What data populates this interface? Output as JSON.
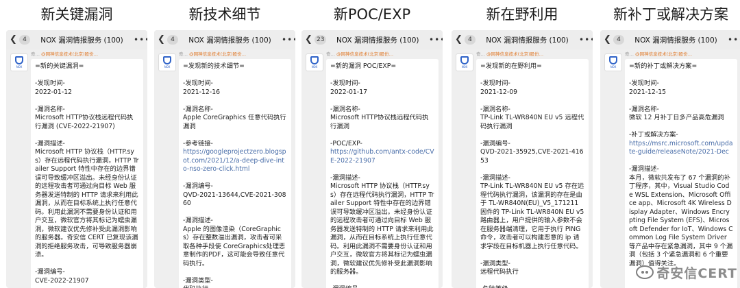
{
  "columns": [
    {
      "heading": "新关键漏洞",
      "badge": "4",
      "title": "NOX 漏洞情报服务 (100)",
      "sender_prefix": "奇…",
      "sender_org": "@网神信息技术(北京)股份…",
      "lines": [
        "=新的关键漏洞=",
        "",
        "-发现时间-",
        "2022-01-12",
        "",
        "-漏洞名称-",
        "Microsoft HTTP协议栈远程代码执行漏洞 (CVE-2022-21907)",
        "",
        "-漏洞描述-",
        "Microsoft HTTP 协议栈（HTTP.sys）存在远程代码执行漏洞，HTTP Trailer Support 特性中存在的边界错误可导致缓冲区溢出。未经身份认证的远程攻击者可通过向目标 Web 服务器发送特制的 HTTP 请求来利用此漏洞，从而在目标系统上执行任意代码。利用此漏洞不需要身份认证和用户交互，微软官方将其标记为蠕虫漏洞，微软建议优先修补受此漏洞影响的服务器。奇安信 CERT 已复现该漏洞的拒绝服务攻击，可导致服务器崩溃。",
        "",
        "-漏洞编号-",
        "CVE-2022-21907"
      ]
    },
    {
      "heading": "新技术细节",
      "badge": "4",
      "title": "NOX 漏洞情报服务 (100)",
      "sender_prefix": "奇…",
      "sender_org": "@网神信息技术(北京)股份…",
      "lines": [
        "=发现新的技术细节=",
        "",
        "-发现时间-",
        "2021-12-16",
        "",
        "-漏洞名称-",
        "Apple CoreGraphics 任意代码执行漏洞",
        "",
        "-参考链接-",
        "https://googleprojectzero.blogspot.com/2021/12/a-deep-dive-into-nso-zero-click.html",
        "",
        "-漏洞编号-",
        "QVD-2021-13644,CVE-2021-30860",
        "",
        "-漏洞描述-",
        "Apple 的图像渲染（CoreGraphics）存在整数溢出漏洞，攻击者可采取各种手段使 CoreGraphics处理恶意制作的PDF，这可能会导致任意代码执行。",
        "",
        "-漏洞类型-",
        "代码执行"
      ]
    },
    {
      "heading": "新POC/EXP",
      "badge": "23",
      "title": "NOX 漏洞情报服务 (100)",
      "sender_prefix": "奇…",
      "sender_org": "@网神信息技术(北京)股份…",
      "lines": [
        "=新的漏洞 POC/EXP=",
        "",
        "-发现时间-",
        "2022-01-17",
        "",
        "-漏洞名称-",
        "Microsoft HTTP协议栈远程代码执行漏洞",
        "",
        "-POC/EXP-",
        "https://github.com/antx-code/CVE-2022-21907",
        "",
        "-漏洞描述-",
        "Microsoft HTTP 协议栈（HTTP.sys）存在远程代码执行漏洞，HTTP Trailer Support 特性中存在的边界错误可导致缓冲区溢出。未经身份认证的远程攻击者可通过向目标 Web 服务器发送特制的 HTTP 请求来利用此漏洞，从而在目标系统上执行任意代码。利用此漏洞不需要身份认证和用户交互，微软官方将其标记为蠕虫漏洞，微软建议优先修补受此漏洞影响的服务器。",
        "",
        "-漏洞编号-"
      ]
    },
    {
      "heading": "新在野利用",
      "badge": "4",
      "title": "NOX 漏洞情报服务 (100)",
      "sender_prefix": "奇…",
      "sender_org": "@网神信息技术(北京)股份…",
      "lines": [
        "=发现新的在野利用=",
        "",
        "-发现时间-",
        "2021-12-09",
        "",
        "-漏洞名称-",
        "TP-Link TL-WR840N EU v5 远程代码执行漏洞",
        "",
        "-漏洞编号-",
        "QVD-2021-35925,CVE-2021-41653",
        "",
        "-漏洞描述-",
        "TP-Link TL-WR840N EU v5 存在远程代码执行漏洞，该漏洞的存在是由于 TL-WR840N(EU)_V5_171211 固件的 TP-Link TL-WR840N EU v5 路由器上，用户提供的输入参数不会在服务器端清理，它用于执行 PING 命令，攻击者可以构建恶意的 ip 请求字段在目标机器上执行任意代码。",
        "",
        "-漏洞类型-",
        "远程代码执行",
        "",
        "-危险等级-"
      ]
    },
    {
      "heading": "新补丁或解决方案",
      "badge": "4",
      "title": "NOX 漏洞情报服务 (100)",
      "sender_prefix": "奇…",
      "sender_org": "@网神信息技术(北京)股份…",
      "lines": [
        "=新的补丁或解决方案=",
        "",
        "-发现时间-",
        "2021-12-15",
        "",
        "-漏洞名称-",
        "微软 12 月补丁日多产品高危漏洞",
        "",
        "-补丁或解决方案-",
        "https://msrc.microsoft.com/update-guide/releaseNote/2021-Dec",
        "",
        "-漏洞描述-",
        "本月，微软共发布了 67 个漏洞的补丁程序，其中，Visual Studio Code WSL Extension、Microsoft Office app、Microsoft 4K Wireless Display Adapter、Windows Encrypting File System (EFS)、Microsoft Defender for IoT、Windows Common Log File System Driver 等产品中存在紧急漏洞，其中 9 个漏洞（包括 3 个紧急漏洞和 6 个重要漏洞）值得关注。"
      ],
      "watermark": "奇安信CERT"
    }
  ]
}
